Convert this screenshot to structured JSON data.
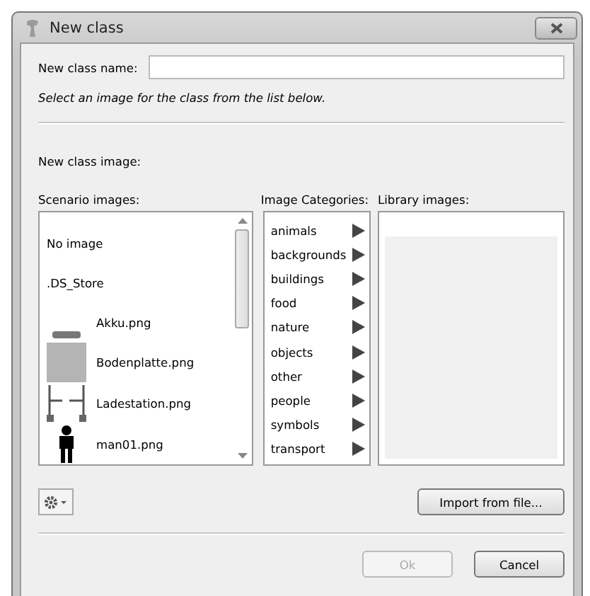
{
  "window": {
    "title": "New class"
  },
  "name_field": {
    "label": "New class name:"
  },
  "hint": "Select an image for the class from the list below.",
  "image_label": "New class image:",
  "scenario": {
    "label": "Scenario images:",
    "items": [
      {
        "name": "No image",
        "kind": "plain",
        "selected": false
      },
      {
        "name": ".DS_Store",
        "kind": "plain",
        "selected": false
      },
      {
        "name": "Akku.png",
        "kind": "bar",
        "selected": false
      },
      {
        "name": "Bodenplatte.png",
        "kind": "tile",
        "selected": false
      },
      {
        "name": "Ladestation.png",
        "kind": "frame",
        "selected": false
      },
      {
        "name": "man01.png",
        "kind": "figure",
        "selected": false
      }
    ]
  },
  "categories": {
    "label": "Image Categories:",
    "items": [
      {
        "name": "animals",
        "selected": false
      },
      {
        "name": "backgrounds",
        "selected": false
      },
      {
        "name": "buildings",
        "selected": false
      },
      {
        "name": "food",
        "selected": false
      },
      {
        "name": "nature",
        "selected": false
      },
      {
        "name": "objects",
        "selected": false
      },
      {
        "name": "other",
        "selected": false
      },
      {
        "name": "people",
        "selected": false
      },
      {
        "name": "symbols",
        "selected": false
      },
      {
        "name": "transport",
        "selected": false
      }
    ]
  },
  "library": {
    "label": "Library images:"
  },
  "buttons": {
    "import": "Import from file...",
    "ok": {
      "label": "Ok",
      "disabled": true
    },
    "cancel": {
      "label": "Cancel",
      "disabled": false
    }
  }
}
